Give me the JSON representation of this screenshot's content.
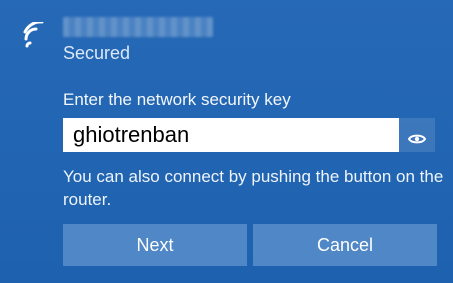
{
  "network": {
    "status": "Secured"
  },
  "form": {
    "prompt": "Enter the network security key",
    "key_value": "ghiotrenban",
    "help_text": "You can also connect by pushing the button on the router."
  },
  "buttons": {
    "next": "Next",
    "cancel": "Cancel"
  },
  "icons": {
    "network": "wifi-icon",
    "reveal": "eye-icon"
  },
  "colors": {
    "panel_background": "#1f64b4",
    "button_background": "#4f87c7",
    "input_background": "#ffffff",
    "text": "#ffffff"
  }
}
